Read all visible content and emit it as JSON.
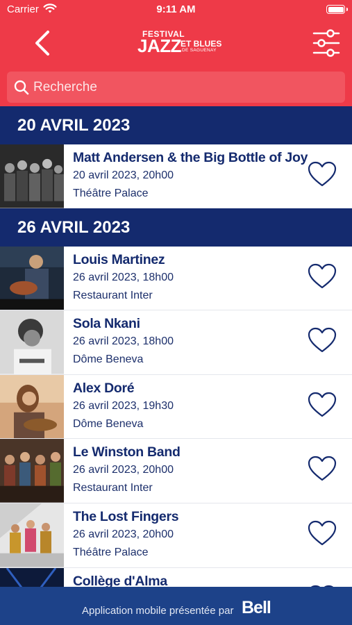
{
  "status_bar": {
    "carrier": "Carrier",
    "time": "9:11 AM"
  },
  "header": {
    "logo": {
      "festival": "FESTIVAL",
      "jazz": "JAZZ",
      "et_blues": "ET BLUES",
      "saguenay": "DE SAGUENAY"
    },
    "back_icon": "chevron-left-icon",
    "filter_icon": "sliders-icon"
  },
  "search": {
    "placeholder": "Recherche",
    "icon": "search-icon"
  },
  "colors": {
    "header_red": "#ee3a48",
    "navy": "#142a6e",
    "footer_blue": "#1d4289"
  },
  "sections": [
    {
      "title": "20 AVRIL 2023",
      "events": [
        {
          "title": "Matt Andersen & the Big Bottle of Joy",
          "datetime": "20 avril 2023, 20h00",
          "venue": "Théâtre Palace",
          "favorite": false
        }
      ]
    },
    {
      "title": "26 AVRIL 2023",
      "events": [
        {
          "title": "Louis Martinez",
          "datetime": "26 avril 2023, 18h00",
          "venue": "Restaurant Inter",
          "favorite": false
        },
        {
          "title": "Sola Nkani",
          "datetime": "26 avril 2023, 18h00",
          "venue": "Dôme Beneva",
          "favorite": false
        },
        {
          "title": "Alex Doré",
          "datetime": "26 avril 2023, 19h30",
          "venue": "Dôme Beneva",
          "favorite": false
        },
        {
          "title": "Le Winston Band",
          "datetime": "26 avril 2023, 20h00",
          "venue": "Restaurant Inter",
          "favorite": false
        },
        {
          "title": "The Lost Fingers",
          "datetime": "26 avril 2023, 20h00",
          "venue": "Théâtre Palace",
          "favorite": false
        },
        {
          "title": "Collège d'Alma",
          "datetime": "",
          "venue": "",
          "favorite": false
        }
      ]
    }
  ],
  "footer": {
    "text": "Application mobile présentée par",
    "sponsor": "Bell"
  }
}
